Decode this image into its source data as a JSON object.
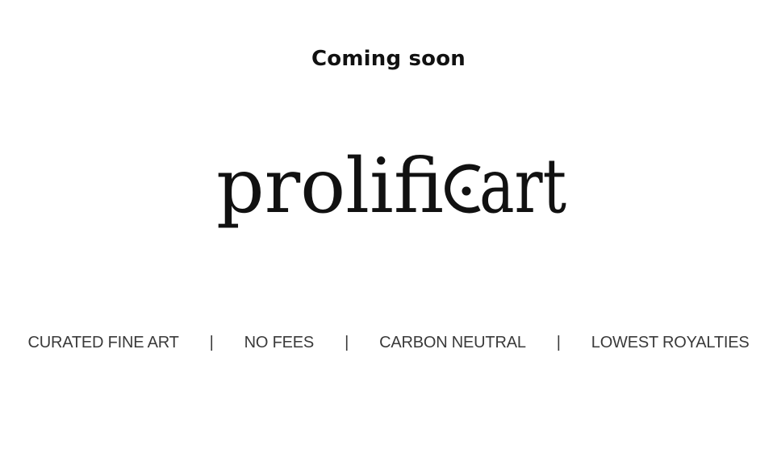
{
  "header": {
    "headline": "Coming soon"
  },
  "logo": {
    "text_left": "prolifi",
    "text_right": "art",
    "color": "#111111"
  },
  "features": {
    "items": [
      "CURATED FINE ART",
      "NO FEES",
      "CARBON NEUTRAL",
      "LOWEST ROYALTIES"
    ],
    "separator": "|"
  }
}
